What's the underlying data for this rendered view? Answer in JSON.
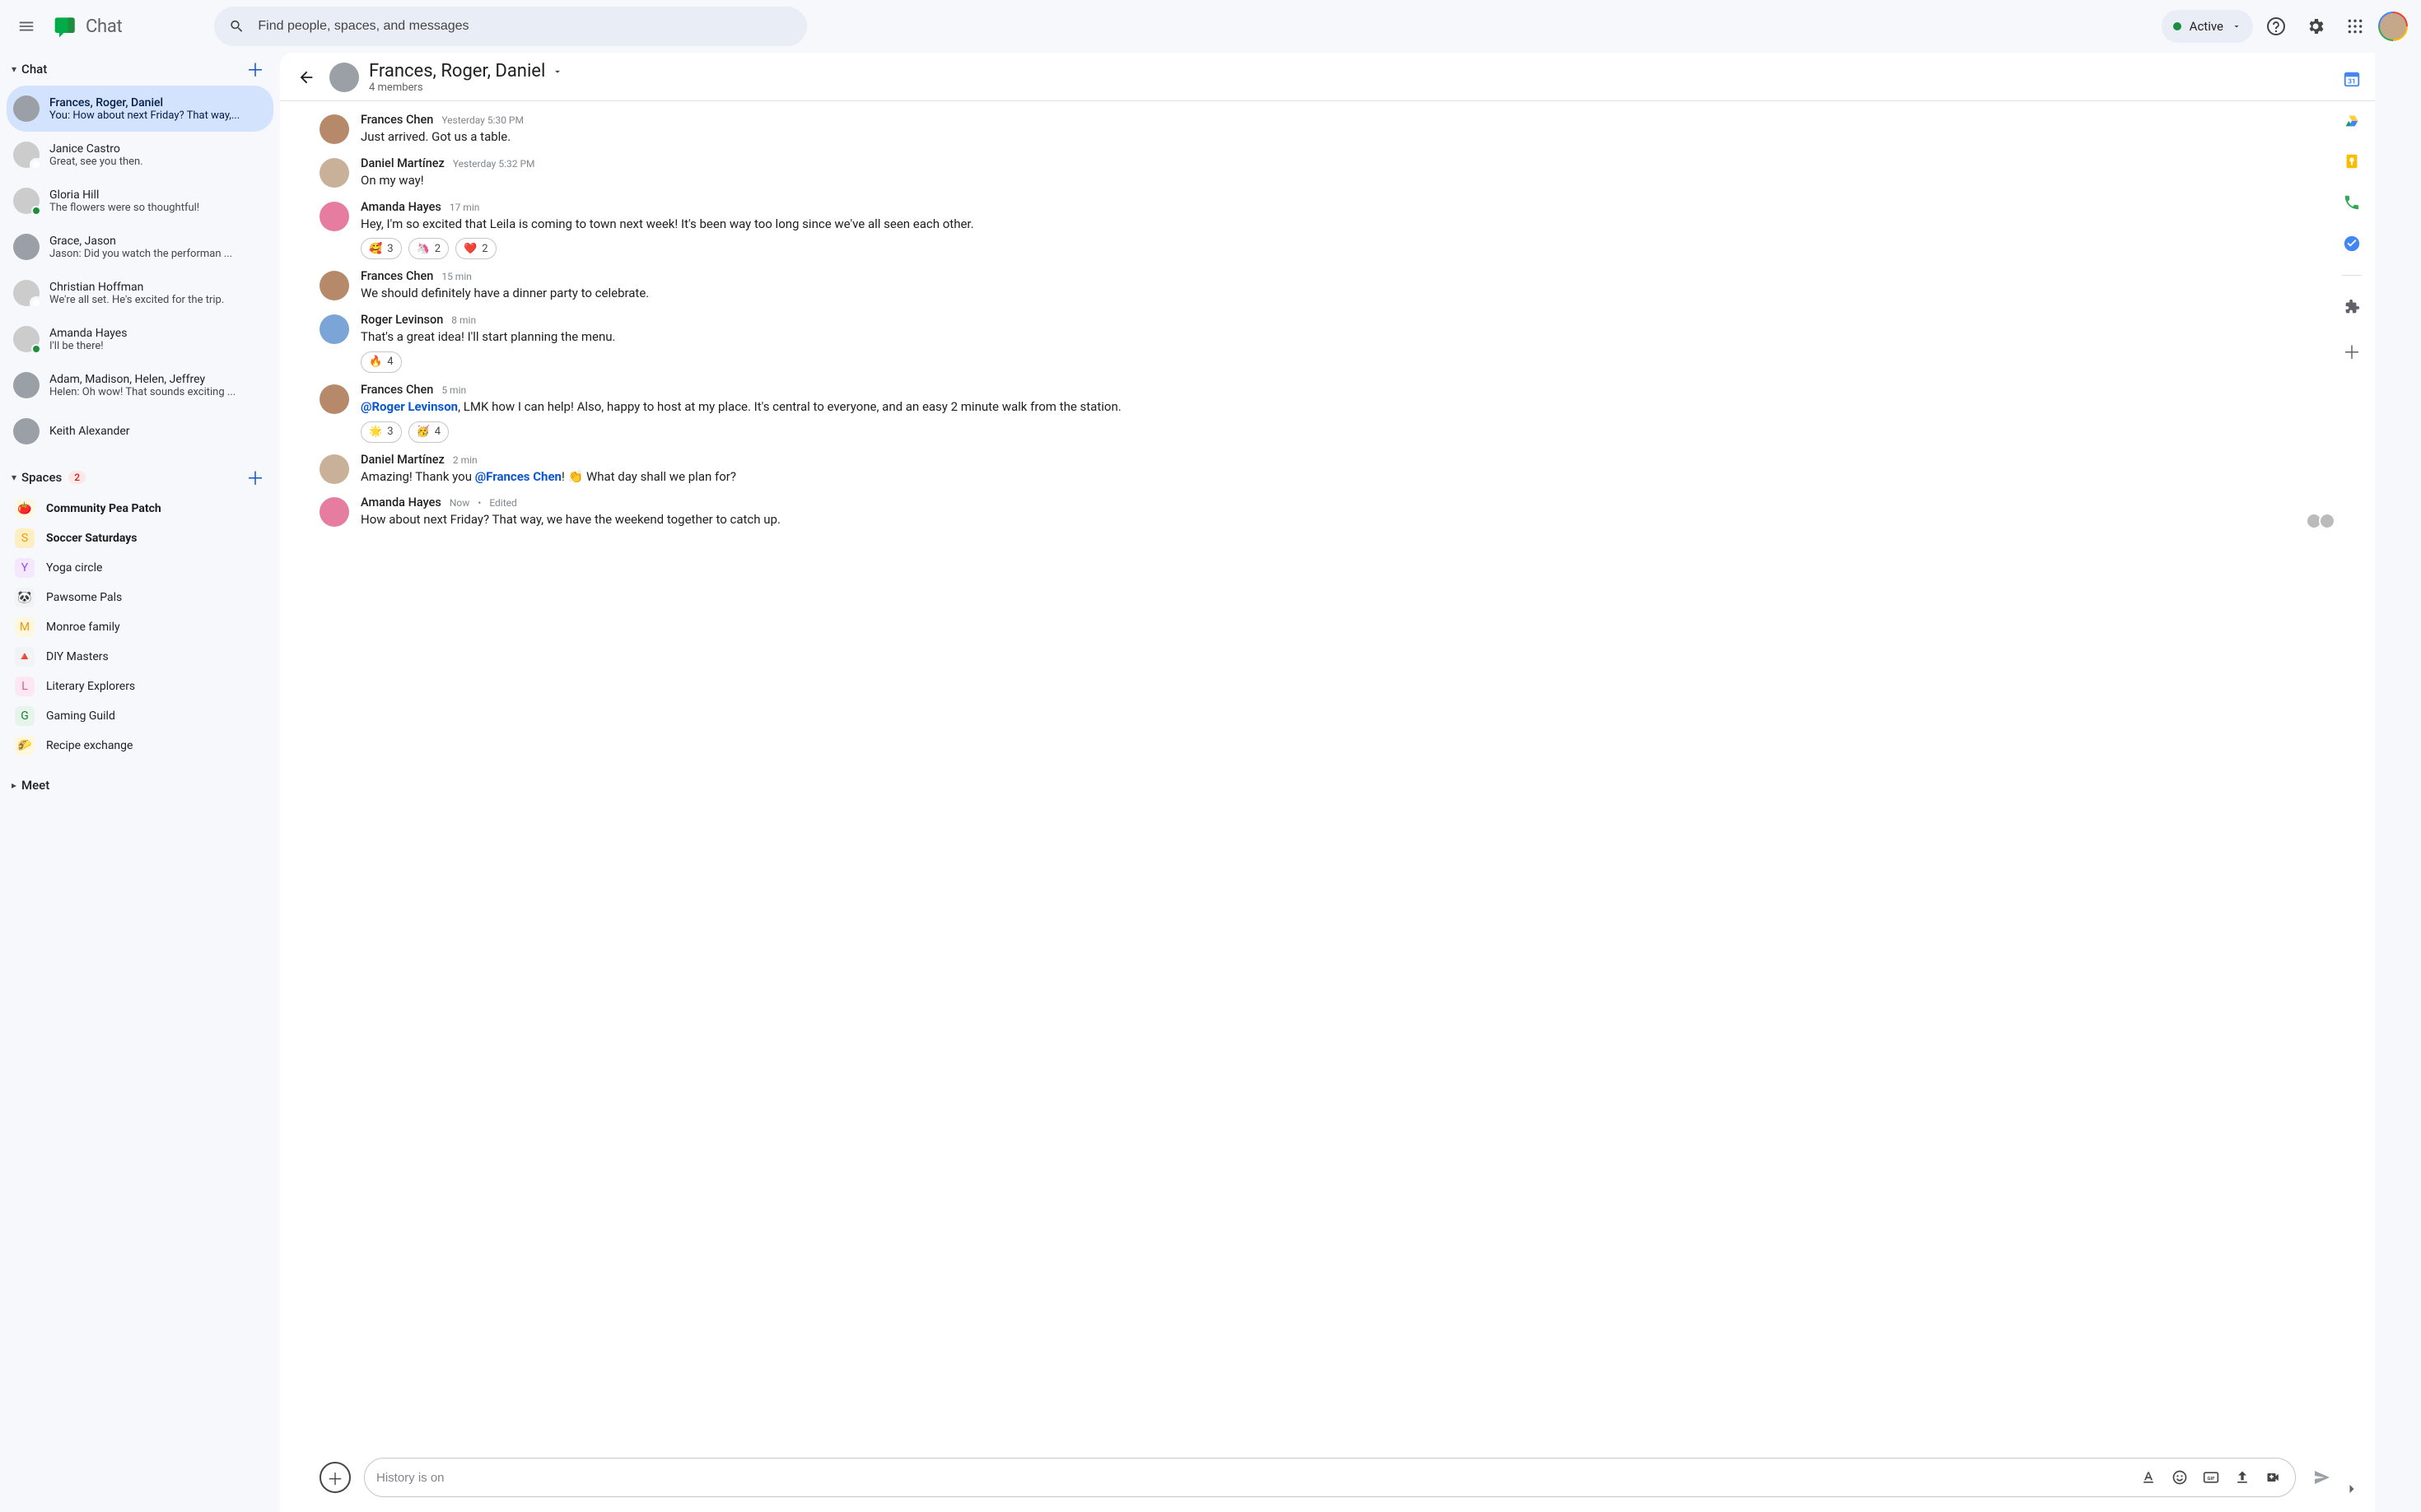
{
  "header": {
    "app_name": "Chat",
    "search_placeholder": "Find people, spaces, and messages",
    "status_label": "Active"
  },
  "sidebar": {
    "chat_section_label": "Chat",
    "spaces_section_label": "Spaces",
    "spaces_badge": "2",
    "meet_section_label": "Meet",
    "chats": [
      {
        "title": "Frances, Roger, Daniel",
        "preview": "You: How about next Friday? That way,...",
        "active": true,
        "group": true
      },
      {
        "title": "Janice Castro",
        "preview": "Great, see you then.",
        "presence": "offline"
      },
      {
        "title": "Gloria Hill",
        "preview": "The flowers were so thoughtful!",
        "presence": "online"
      },
      {
        "title": "Grace, Jason",
        "preview": "Jason: Did you watch the performan ...",
        "group": true
      },
      {
        "title": "Christian Hoffman",
        "preview": "We're all set.  He's excited for the trip.",
        "presence": "offline"
      },
      {
        "title": "Amanda Hayes",
        "preview": "I'll be there!",
        "presence": "online"
      },
      {
        "title": "Adam, Madison, Helen, Jeffrey",
        "preview": "Helen: Oh wow! That sounds exciting ...",
        "group": true
      },
      {
        "title": "Keith  Alexander",
        "preview": "",
        "group": true
      }
    ],
    "spaces": [
      {
        "name": "Community Pea Patch",
        "bold": true,
        "icon": "🍅",
        "bg": "#fef7e0"
      },
      {
        "name": "Soccer Saturdays",
        "bold": true,
        "icon": "S",
        "bg": "#feefc3",
        "fg": "#f29900"
      },
      {
        "name": "Yoga circle",
        "icon": "Y",
        "bg": "#f3e8fd",
        "fg": "#a142f4"
      },
      {
        "name": "Pawsome Pals",
        "icon": "🐼",
        "bg": "#f1f3f4"
      },
      {
        "name": "Monroe family",
        "icon": "M",
        "bg": "#fef7e0",
        "fg": "#f29900"
      },
      {
        "name": "DIY Masters",
        "icon": "🔺",
        "bg": "#f1f3f4"
      },
      {
        "name": "Literary Explorers",
        "icon": "L",
        "bg": "#fde7f3",
        "fg": "#d85b9a"
      },
      {
        "name": "Gaming Guild",
        "icon": "G",
        "bg": "#e6f4ea",
        "fg": "#188038"
      },
      {
        "name": "Recipe exchange",
        "icon": "🌮",
        "bg": "#fef7e0"
      }
    ]
  },
  "conversation": {
    "title": "Frances, Roger, Daniel",
    "subtitle": "4 members",
    "composer_placeholder": "History is on"
  },
  "messages": [
    {
      "author": "Frances Chen",
      "time": "Yesterday 5:30 PM",
      "text": "Just arrived.  Got us a table.",
      "avatar": "bg-brown"
    },
    {
      "author": "Daniel Martínez",
      "time": "Yesterday 5:32 PM",
      "text": "On my way!",
      "avatar": "bg-tan"
    },
    {
      "author": "Amanda Hayes",
      "time": "17 min",
      "text": "Hey, I'm so excited that Leila is coming to town next week! It's been way too long since we've all seen each other.",
      "avatar": "bg-pink",
      "reactions": [
        {
          "emoji": "🥰",
          "count": "3"
        },
        {
          "emoji": "🦄",
          "count": "2"
        },
        {
          "emoji": "❤️",
          "count": "2"
        }
      ]
    },
    {
      "author": "Frances Chen",
      "time": "15 min",
      "text": "We should definitely have a dinner party to celebrate.",
      "avatar": "bg-brown"
    },
    {
      "author": "Roger Levinson",
      "time": "8 min",
      "text": "That's a great idea! I'll start planning the menu.",
      "avatar": "bg-blue",
      "reactions": [
        {
          "emoji": "🔥",
          "count": "4"
        }
      ]
    },
    {
      "author": "Frances Chen",
      "time": "5 min",
      "parts": [
        {
          "mention": "@Roger Levinson"
        },
        {
          "text": ", LMK how I can help!  Also, happy to host at my place. It's central to everyone, and an easy 2 minute walk from the station."
        }
      ],
      "avatar": "bg-brown",
      "reactions": [
        {
          "emoji": "🌟",
          "count": "3"
        },
        {
          "emoji": "🥳",
          "count": "4"
        }
      ]
    },
    {
      "author": "Daniel Martínez",
      "time": "2 min",
      "parts": [
        {
          "text": "Amazing! Thank you "
        },
        {
          "mention": "@Frances Chen"
        },
        {
          "text": "! 👏 What day shall we plan for?"
        }
      ],
      "avatar": "bg-tan"
    },
    {
      "author": "Amanda Hayes",
      "time": "Now",
      "edited": "Edited",
      "text": "How about next Friday? That way, we have the weekend together to catch up.",
      "avatar": "bg-pink",
      "read_by": 2
    }
  ]
}
